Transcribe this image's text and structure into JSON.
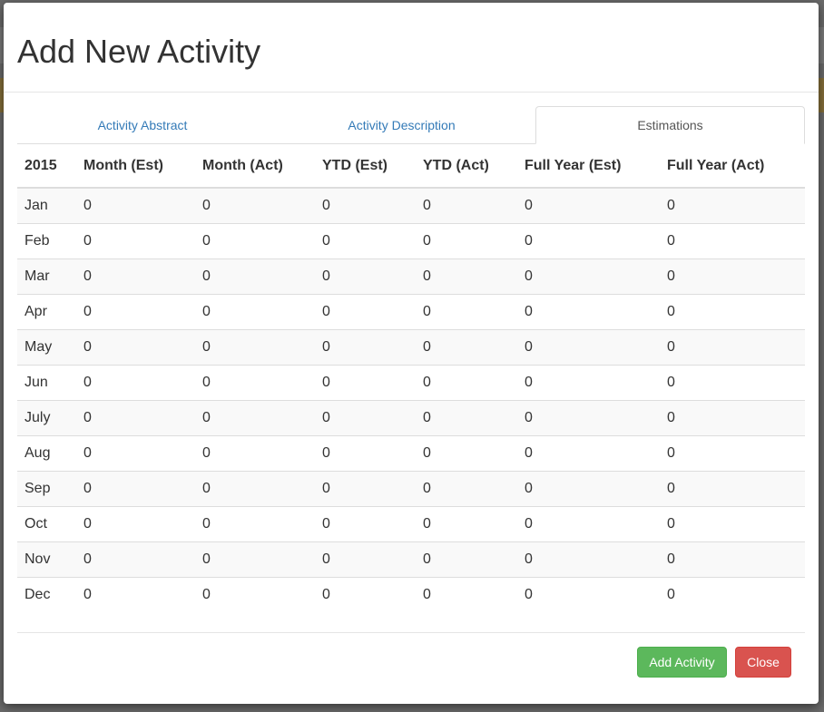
{
  "modal": {
    "title": "Add New Activity"
  },
  "tabs": [
    {
      "label": "Activity Abstract",
      "active": false
    },
    {
      "label": "Activity Description",
      "active": false
    },
    {
      "label": "Estimations",
      "active": true
    }
  ],
  "table": {
    "headers": [
      "2015",
      "Month (Est)",
      "Month (Act)",
      "YTD (Est)",
      "YTD (Act)",
      "Full Year (Est)",
      "Full Year (Act)"
    ],
    "rows": [
      [
        "Jan",
        "0",
        "0",
        "0",
        "0",
        "0",
        "0"
      ],
      [
        "Feb",
        "0",
        "0",
        "0",
        "0",
        "0",
        "0"
      ],
      [
        "Mar",
        "0",
        "0",
        "0",
        "0",
        "0",
        "0"
      ],
      [
        "Apr",
        "0",
        "0",
        "0",
        "0",
        "0",
        "0"
      ],
      [
        "May",
        "0",
        "0",
        "0",
        "0",
        "0",
        "0"
      ],
      [
        "Jun",
        "0",
        "0",
        "0",
        "0",
        "0",
        "0"
      ],
      [
        "July",
        "0",
        "0",
        "0",
        "0",
        "0",
        "0"
      ],
      [
        "Aug",
        "0",
        "0",
        "0",
        "0",
        "0",
        "0"
      ],
      [
        "Sep",
        "0",
        "0",
        "0",
        "0",
        "0",
        "0"
      ],
      [
        "Oct",
        "0",
        "0",
        "0",
        "0",
        "0",
        "0"
      ],
      [
        "Nov",
        "0",
        "0",
        "0",
        "0",
        "0",
        "0"
      ],
      [
        "Dec",
        "0",
        "0",
        "0",
        "0",
        "0",
        "0"
      ]
    ]
  },
  "footer": {
    "add_label": "Add Activity",
    "close_label": "Close"
  },
  "colors": {
    "link": "#337ab7",
    "success": "#5cb85c",
    "danger": "#d9534f"
  }
}
